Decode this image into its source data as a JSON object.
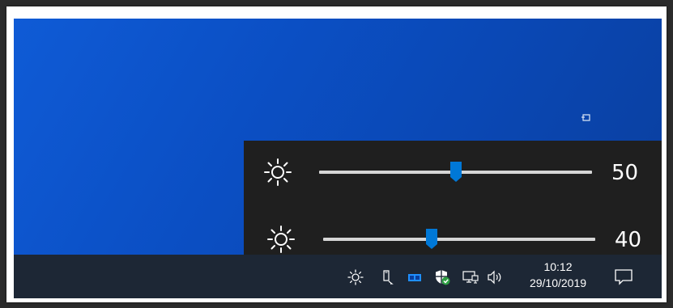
{
  "flyout": {
    "sliders": [
      {
        "icon": "sun-brightness-icon",
        "value_label": "50",
        "value": 50,
        "max": 100
      },
      {
        "icon": "sun-brightness-icon",
        "value_label": "40",
        "value": 40,
        "max": 100
      }
    ]
  },
  "taskbar": {
    "tray_icons": [
      "brightness-icon",
      "usb-device-icon",
      "app-tray-icon",
      "security-shield-icon",
      "network-icon",
      "volume-icon"
    ],
    "time": "10:12",
    "date": "29/10/2019",
    "notification_icon": "action-center-icon"
  },
  "colors": {
    "desktop": "#0b4fc4",
    "flyout_bg": "#1f1f1f",
    "taskbar_bg": "#1d2735",
    "accent": "#0078d7",
    "track": "#d6d6d6",
    "shield_check": "#2ea043"
  }
}
